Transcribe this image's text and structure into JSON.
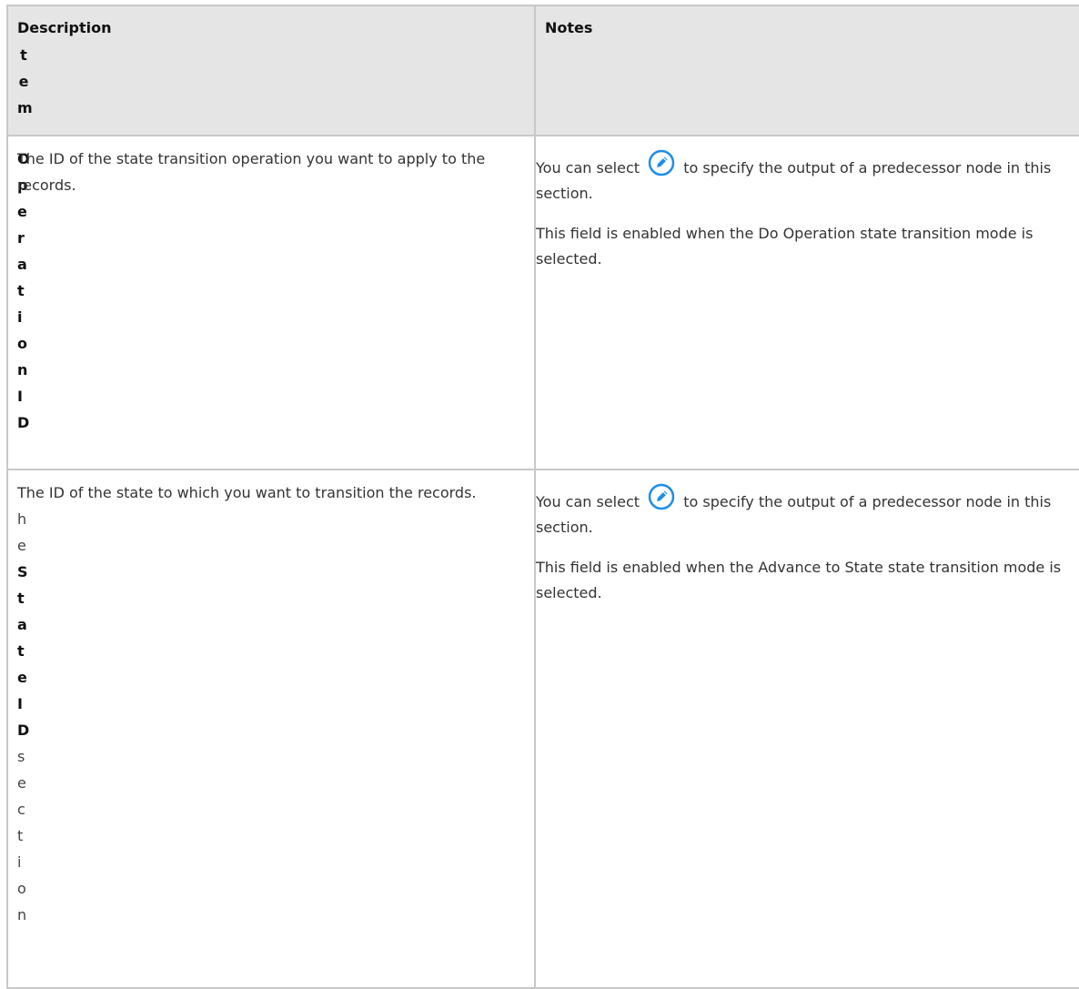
{
  "table": {
    "header": {
      "item_letters": [
        "t",
        "e",
        "m"
      ],
      "description": "Description",
      "notes": "Notes"
    },
    "rows": [
      {
        "item_letters": [
          "O",
          "p",
          "e",
          "r",
          "a",
          "t",
          "i",
          "o",
          "n",
          "I",
          "D"
        ],
        "description": "The ID of the state transition operation you want to apply to the records.",
        "notes_select_before": "You can select",
        "notes_select_after": "to specify the output of a predecessor node in this section.",
        "notes_enabled": "This field is enabled when the Do Operation state transition mode is selected."
      },
      {
        "item_letters_plain_top": [
          "h",
          "e"
        ],
        "item_letters_bold": [
          "S",
          "t",
          "a",
          "t",
          "e",
          "I",
          "D"
        ],
        "item_letters_plain_bottom": [
          "s",
          "e",
          "c",
          "t",
          "i",
          "o",
          "n"
        ],
        "description": "The ID of the state to which you want to transition the records.",
        "notes_select_before": "You can select",
        "notes_select_after": "to specify the output of a predecessor node in this section.",
        "notes_enabled": "This field is enabled when the Advance to State state transition mode is selected."
      }
    ]
  },
  "icons": {
    "edit": "pencil-circle-icon",
    "edit_color": "#1f8dea"
  }
}
